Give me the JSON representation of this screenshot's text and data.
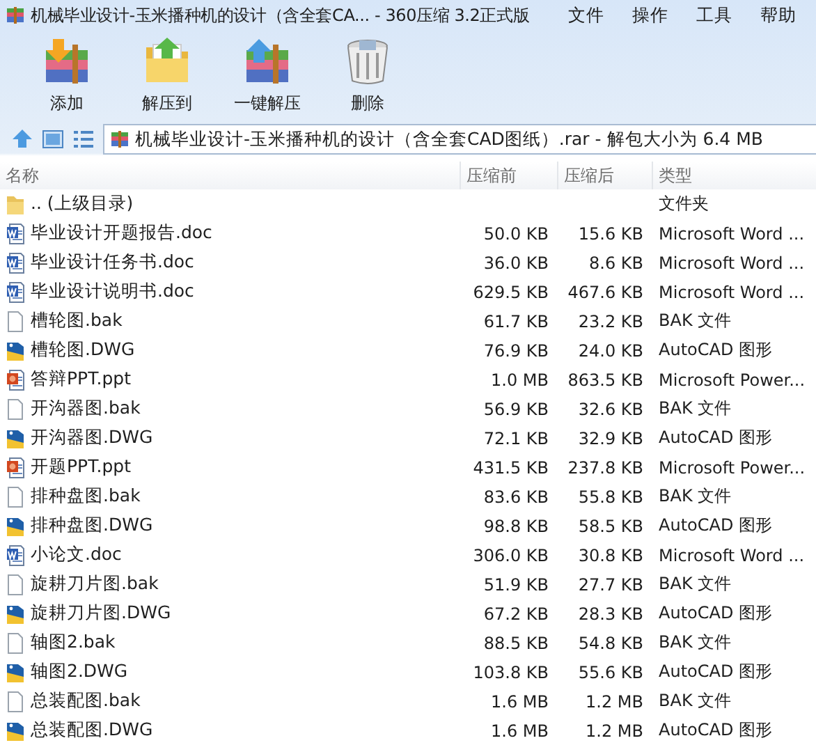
{
  "window": {
    "title": "机械毕业设计-玉米播种机的设计（含全套CA... - 360压缩 3.2正式版"
  },
  "menu": [
    "文件",
    "操作",
    "工具",
    "帮助"
  ],
  "toolbar": [
    {
      "kind": "add",
      "label": "添加"
    },
    {
      "kind": "extract",
      "label": "解压到"
    },
    {
      "kind": "quick",
      "label": "一键解压"
    },
    {
      "kind": "delete",
      "label": "删除"
    }
  ],
  "address": {
    "value": "机械毕业设计-玉米播种机的设计（含全套CAD图纸）.rar - 解包大小为 6.4 MB"
  },
  "table": {
    "columns": [
      "名称",
      "压缩前",
      "压缩后",
      "类型"
    ],
    "rows": [
      {
        "kind": "folder",
        "name": ".. (上级目录)",
        "before": "",
        "after": "",
        "type": "文件夹"
      },
      {
        "kind": "doc",
        "name": "毕业设计开题报告.doc",
        "before": "50.0 KB",
        "after": "15.6 KB",
        "type": "Microsoft Word ..."
      },
      {
        "kind": "doc",
        "name": "毕业设计任务书.doc",
        "before": "36.0 KB",
        "after": "8.6 KB",
        "type": "Microsoft Word ..."
      },
      {
        "kind": "doc",
        "name": "毕业设计说明书.doc",
        "before": "629.5 KB",
        "after": "467.6 KB",
        "type": "Microsoft Word ..."
      },
      {
        "kind": "bak",
        "name": "槽轮图.bak",
        "before": "61.7 KB",
        "after": "23.2 KB",
        "type": "BAK 文件"
      },
      {
        "kind": "dwg",
        "name": "槽轮图.DWG",
        "before": "76.9 KB",
        "after": "24.0 KB",
        "type": "AutoCAD 图形"
      },
      {
        "kind": "ppt",
        "name": "答辩PPT.ppt",
        "before": "1.0 MB",
        "after": "863.5 KB",
        "type": "Microsoft Power..."
      },
      {
        "kind": "bak",
        "name": "开沟器图.bak",
        "before": "56.9 KB",
        "after": "32.6 KB",
        "type": "BAK 文件"
      },
      {
        "kind": "dwg",
        "name": "开沟器图.DWG",
        "before": "72.1 KB",
        "after": "32.9 KB",
        "type": "AutoCAD 图形"
      },
      {
        "kind": "ppt",
        "name": "开题PPT.ppt",
        "before": "431.5 KB",
        "after": "237.8 KB",
        "type": "Microsoft Power..."
      },
      {
        "kind": "bak",
        "name": "排种盘图.bak",
        "before": "83.6 KB",
        "after": "55.8 KB",
        "type": "BAK 文件"
      },
      {
        "kind": "dwg",
        "name": "排种盘图.DWG",
        "before": "98.8 KB",
        "after": "58.5 KB",
        "type": "AutoCAD 图形"
      },
      {
        "kind": "doc",
        "name": "小论文.doc",
        "before": "306.0 KB",
        "after": "30.8 KB",
        "type": "Microsoft Word ..."
      },
      {
        "kind": "bak",
        "name": "旋耕刀片图.bak",
        "before": "51.9 KB",
        "after": "27.7 KB",
        "type": "BAK 文件"
      },
      {
        "kind": "dwg",
        "name": "旋耕刀片图.DWG",
        "before": "67.2 KB",
        "after": "28.3 KB",
        "type": "AutoCAD 图形"
      },
      {
        "kind": "bak",
        "name": "轴图2.bak",
        "before": "88.5 KB",
        "after": "54.8 KB",
        "type": "BAK 文件"
      },
      {
        "kind": "dwg",
        "name": "轴图2.DWG",
        "before": "103.8 KB",
        "after": "55.6 KB",
        "type": "AutoCAD 图形"
      },
      {
        "kind": "bak",
        "name": "总装配图.bak",
        "before": "1.6 MB",
        "after": "1.2 MB",
        "type": "BAK 文件"
      },
      {
        "kind": "dwg",
        "name": "总装配图.DWG",
        "before": "1.6 MB",
        "after": "1.2 MB",
        "type": "AutoCAD 图形"
      }
    ]
  }
}
